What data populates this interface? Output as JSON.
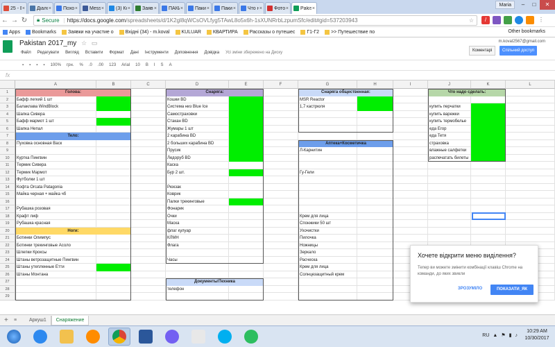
{
  "browser": {
    "tabs": [
      {
        "label": "25 - Е",
        "color": "#dd4b39"
      },
      {
        "label": "Діало",
        "color": "#4a76a8"
      },
      {
        "label": "Похо",
        "color": "#3b78e7"
      },
      {
        "label": "Mess",
        "color": "#3b5998"
      },
      {
        "label": "(3) Ко",
        "color": "#1e88e5"
      },
      {
        "label": "Заяв",
        "color": "#2e7d32"
      },
      {
        "label": "ПАКИ",
        "color": "#3b78e7"
      },
      {
        "label": "Паки",
        "color": "#3b78e7"
      },
      {
        "label": "Паки",
        "color": "#3b78e7"
      },
      {
        "label": "Что н",
        "color": "#3b78e7"
      },
      {
        "label": "Фото",
        "color": "#d32f2f"
      },
      {
        "label": "Pakis",
        "color": "#0f9d58"
      }
    ],
    "user": "Maria",
    "url_host": "https://docs.google.com",
    "url_path": "/spreadsheets/d/1K2gl8qWCsOVLfyg5TAwL8o5x6h-1sXUNRrbLzpumSfc/edit#gid=537203943",
    "secure_label": "Secure",
    "bookmarks": [
      "Apps",
      "Bookmarks",
      "Заявки на участие о",
      "Вхідні (34) - m.koval",
      "KULUAR",
      "КВАРТИРА",
      "Рассказы о путешес",
      "Г1-Г2",
      ">> Путешествие по"
    ],
    "other_bookmarks": "Other bookmarks"
  },
  "doc": {
    "title": "Pakistan 2017_my",
    "star": "☆",
    "menus": [
      "Файл",
      "Редагувати",
      "Вигляд",
      "Вставити",
      "Формат",
      "Дані",
      "Інструменти",
      "Доповнення",
      "Довідка"
    ],
    "saved": "Усі зміни збережено на Диску",
    "email": "m.koval2567@gmail.com",
    "comments_label": "Коментарі",
    "share_label": "Спільний доступ",
    "toolbar": [
      "100%",
      "грн.",
      "%",
      ".0",
      ".00",
      "123",
      "Arial",
      "10",
      "B",
      "I",
      "S",
      "A"
    ],
    "fx": "fx"
  },
  "grid": {
    "columns": [
      "A",
      "B",
      "C",
      "D",
      "E",
      "F",
      "G",
      "H",
      "I",
      "J",
      "K",
      "L"
    ],
    "rows": [
      "1",
      "2",
      "3",
      "4",
      "5",
      "6",
      "7",
      "8",
      "9",
      "10",
      "11",
      "12",
      "13",
      "14",
      "15",
      "16",
      "17",
      "18",
      "19",
      "20",
      "21",
      "22",
      "23",
      "24",
      "25",
      "26",
      "27",
      "28",
      "29"
    ]
  },
  "sheet": {
    "head_golova": "Голова:",
    "head_sporyadzhenie": "Снаряга:",
    "head_obshchestvennaya": "Снаряга общественная:",
    "head_chto_sdelat": "Что надо сделать:",
    "head_telo": "Тело:",
    "head_apteka": "Аптека+Косметичка",
    "head_nogi": "Ноги:",
    "head_dokumenty": "Документы\\Техника",
    "col_a": [
      {
        "row": 2,
        "text": "Бафф легкий 1 шт"
      },
      {
        "row": 3,
        "text": "Балаклава WindBlock"
      },
      {
        "row": 4,
        "text": "Шапка Сивера"
      },
      {
        "row": 5,
        "text": "Бафф мармот 1 шт"
      },
      {
        "row": 6,
        "text": "Шапка Непал"
      },
      {
        "row": 8,
        "text": "Пуховка основная Baск"
      },
      {
        "row": 10,
        "text": "Куртка Пингвин"
      },
      {
        "row": 11,
        "text": "Термик Сивера"
      },
      {
        "row": 12,
        "text": "Термик Мармот"
      },
      {
        "row": 13,
        "text": "Футболки 1 шт"
      },
      {
        "row": 14,
        "text": "Кофта Orcata Patagonia"
      },
      {
        "row": 15,
        "text": "Майка черная + майка чб"
      },
      {
        "row": 17,
        "text": "Рубашка розовая"
      },
      {
        "row": 18,
        "text": "Крафт лиф"
      },
      {
        "row": 19,
        "text": "Рубашка красная"
      },
      {
        "row": 21,
        "text": "Ботинки Олимпус"
      },
      {
        "row": 22,
        "text": "Ботинки трекинговые Асоло"
      },
      {
        "row": 23,
        "text": "Шлепки Кроксы"
      },
      {
        "row": 24,
        "text": "Штаны ветрозащитные Пингвин"
      },
      {
        "row": 25,
        "text": "Штаны утепленные Етти"
      },
      {
        "row": 26,
        "text": "Штаны Монтана"
      }
    ],
    "col_d": [
      {
        "row": 2,
        "text": "Кошки BD"
      },
      {
        "row": 3,
        "text": "Система низ Blue Ice"
      },
      {
        "row": 4,
        "text": "Самостраховки"
      },
      {
        "row": 5,
        "text": "Стакан BD"
      },
      {
        "row": 6,
        "text": "Жумары 1 шт"
      },
      {
        "row": 7,
        "text": "2 карабина BD"
      },
      {
        "row": 8,
        "text": "2 больших карабина BD"
      },
      {
        "row": 9,
        "text": "Прусик"
      },
      {
        "row": 10,
        "text": "Ледоруб BD"
      },
      {
        "row": 11,
        "text": "Каска"
      },
      {
        "row": 12,
        "text": "Бур 2 шт."
      },
      {
        "row": 14,
        "text": "Рюкзак"
      },
      {
        "row": 15,
        "text": "Коврик"
      },
      {
        "row": 16,
        "text": "Палки трекинговые"
      },
      {
        "row": 17,
        "text": "Фонарик"
      },
      {
        "row": 18,
        "text": "Очки"
      },
      {
        "row": 19,
        "text": "Маска"
      },
      {
        "row": 20,
        "text": "флаг кулуар"
      },
      {
        "row": 21,
        "text": "КЛМН"
      },
      {
        "row": 22,
        "text": "Флага"
      },
      {
        "row": 24,
        "text": "Часы"
      },
      {
        "row": 28,
        "text": "телефон"
      }
    ],
    "col_g": [
      {
        "row": 2,
        "text": "MSR Reactor"
      },
      {
        "row": 3,
        "text": "1,7 кастрюля"
      },
      {
        "row": 9,
        "text": "Л-Карнитин"
      },
      {
        "row": 12,
        "text": "Гу-Гели"
      },
      {
        "row": 18,
        "text": "Крем для лица"
      },
      {
        "row": 19,
        "text": "Спонжики 50 шт"
      },
      {
        "row": 20,
        "text": "Ухочистки"
      },
      {
        "row": 21,
        "text": "Пилочка"
      },
      {
        "row": 22,
        "text": "Ножницы"
      },
      {
        "row": 23,
        "text": "Зеркало"
      },
      {
        "row": 24,
        "text": "Расческа"
      },
      {
        "row": 25,
        "text": "Крем для лица"
      },
      {
        "row": 26,
        "text": "Солнцезащитный крем"
      }
    ],
    "col_j": [
      {
        "row": 3,
        "text": "купить перчатки"
      },
      {
        "row": 4,
        "text": "купить варежки"
      },
      {
        "row": 5,
        "text": "купить термобелье"
      },
      {
        "row": 6,
        "text": "еда Егор"
      },
      {
        "row": 7,
        "text": "еда Тетя"
      },
      {
        "row": 8,
        "text": "страховка"
      },
      {
        "row": 9,
        "text": "влажные салфетки"
      },
      {
        "row": 10,
        "text": "распечатать билеты"
      }
    ],
    "header_colors": {
      "golova": "#ea9999",
      "sporyadzhenie": "#b4a7d6",
      "obshchestvennaya": "#c9daf8",
      "chto_sdelat": "#b6d7a8",
      "telo": "#6d9eeb",
      "apteka": "#6d9eeb",
      "nogi": "#ffd966",
      "dokumenty": "#c9daf8"
    },
    "checked_color": "#00ee00"
  },
  "sheet_tabs": [
    "Аркуш1",
    "Снаряжение"
  ],
  "popup": {
    "title": "Хочете відкрити меню виділення?",
    "body": "Тепер ви можете змінити комбінації клавіш Chrome на команди, до яких звикли",
    "ok": "ЗРОЗУМІЛО",
    "show": "ПОКАЗАТИ_ЯК"
  },
  "taskbar": {
    "lang": "RU",
    "time": "10:29 AM",
    "date": "10/30/2017"
  }
}
